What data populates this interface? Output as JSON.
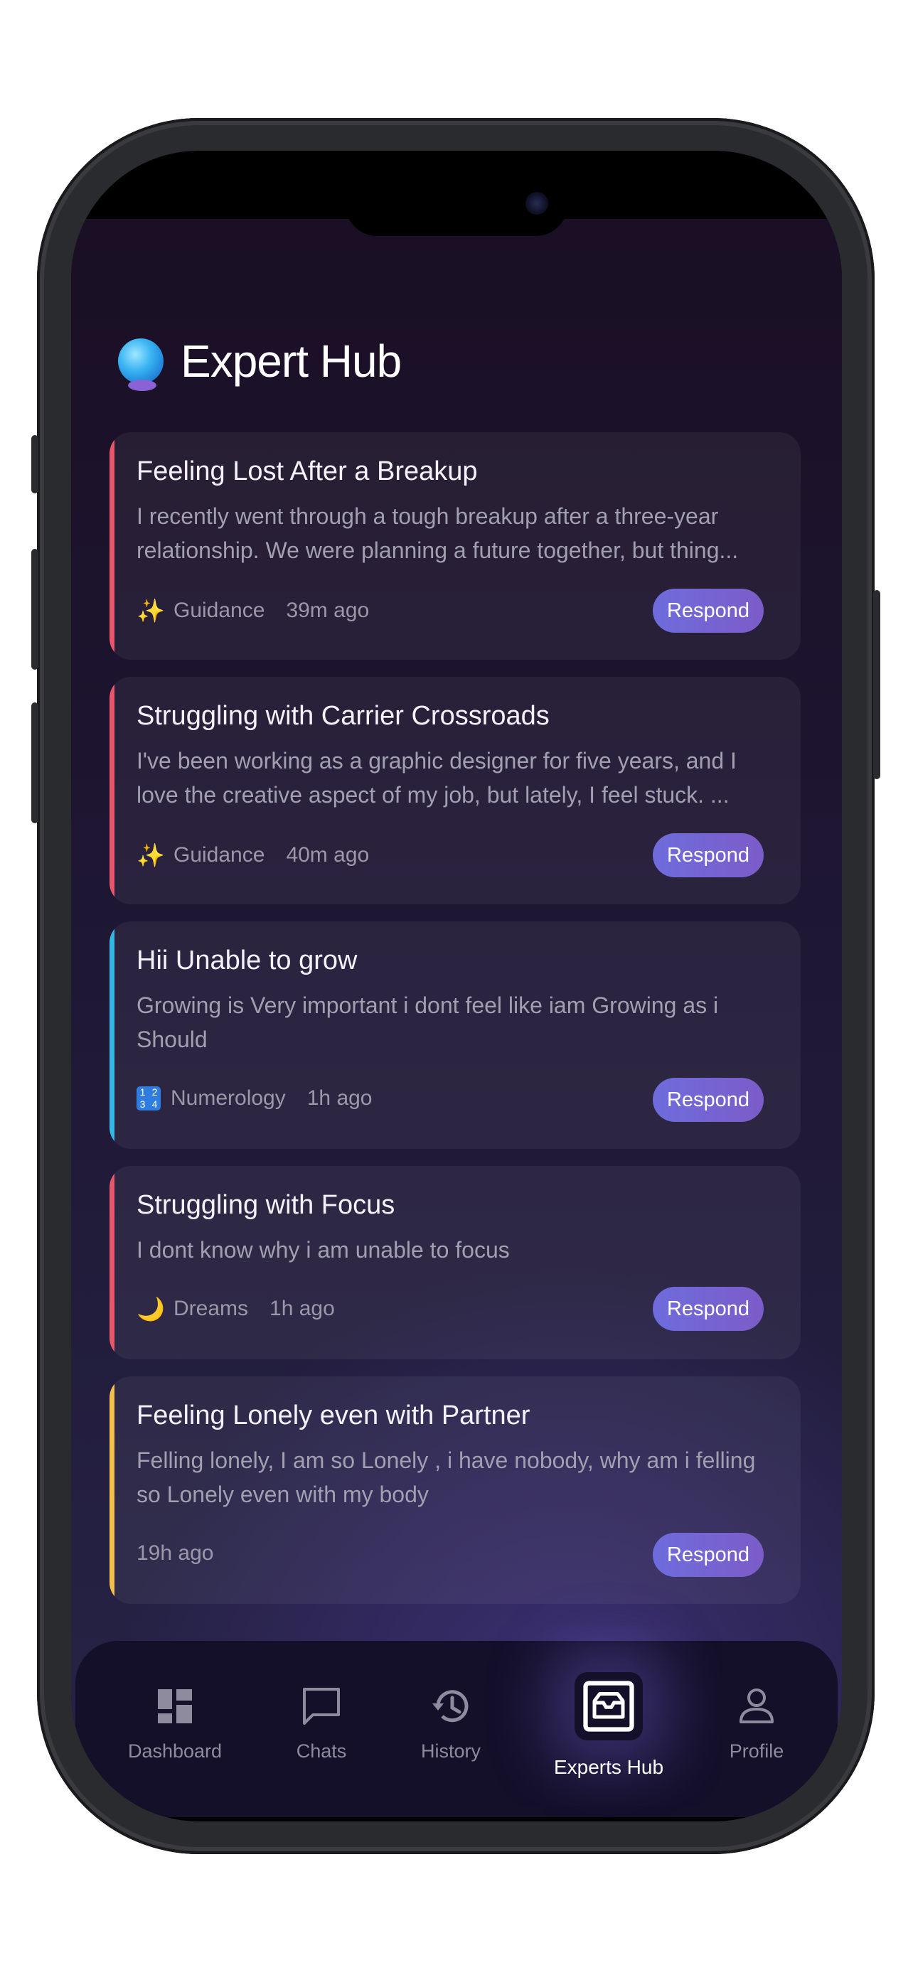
{
  "header": {
    "title": "Expert Hub",
    "icon": "crystal-ball-icon"
  },
  "cards": [
    {
      "title": "Feeling Lost After a Breakup",
      "body": "I recently went through a tough breakup after a three-year relationship. We were planning a future together, but thing...",
      "category_icon": "sparkles-icon",
      "category_glyph": "✨",
      "category": "Guidance",
      "time": "39m ago",
      "respond": "Respond",
      "accent": "#e8566b"
    },
    {
      "title": "Struggling with Carrier Crossroads",
      "body": "I've been working as a graphic designer for five years, and I love the creative aspect of my job, but lately, I feel stuck. ...",
      "category_icon": "sparkles-icon",
      "category_glyph": "✨",
      "category": "Guidance",
      "time": "40m ago",
      "respond": "Respond",
      "accent": "#e8566b"
    },
    {
      "title": "Hii Unable to grow",
      "body": "Growing is Very important i dont feel like iam Growing as i Should",
      "category_icon": "numbers-icon",
      "category_glyph": "1234",
      "category": "Numerology",
      "time": "1h ago",
      "respond": "Respond",
      "accent": "#35b7e6"
    },
    {
      "title": "Struggling with Focus",
      "body": "I dont know why i am unable to focus",
      "category_icon": "crescent-moon-icon",
      "category_glyph": "🌙",
      "category": "Dreams",
      "time": "1h ago",
      "respond": "Respond",
      "accent": "#e8566b"
    },
    {
      "title": "Feeling Lonely even with Partner",
      "body": "Felling lonely, I am so Lonely , i have nobody, why am i felling so Lonely even with my body",
      "category_icon": "",
      "category_glyph": "",
      "category": "",
      "time": "19h ago",
      "respond": "Respond",
      "accent": "#f2c04b"
    }
  ],
  "tabs": [
    {
      "label": "Dashboard",
      "icon": "dashboard-icon",
      "active": false
    },
    {
      "label": "Chats",
      "icon": "chat-bubble-icon",
      "active": false
    },
    {
      "label": "History",
      "icon": "history-icon",
      "active": false
    },
    {
      "label": "Experts Hub",
      "icon": "inbox-icon",
      "active": true
    },
    {
      "label": "Profile",
      "icon": "person-icon",
      "active": false
    }
  ]
}
